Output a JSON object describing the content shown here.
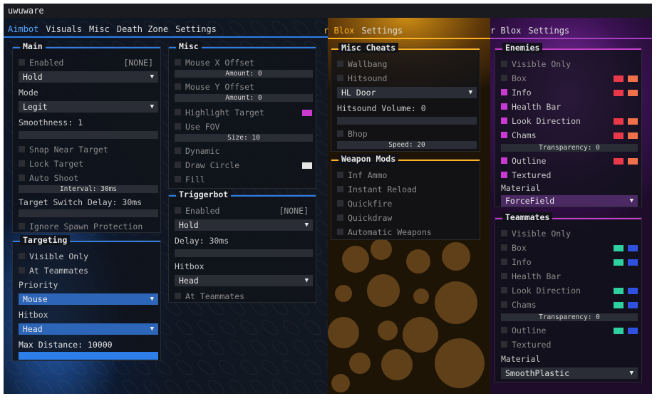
{
  "window": {
    "title": "uwuware"
  },
  "colors": {
    "blue": "#2d7ee8",
    "amber": "#ffb120",
    "purple": "#c93bd0"
  },
  "aimbot_window": {
    "tabs": [
      {
        "label": "Aimbot",
        "active": true
      },
      {
        "label": "Visuals",
        "active": false
      },
      {
        "label": "Misc",
        "active": false
      },
      {
        "label": "Death Zone",
        "active": false
      },
      {
        "label": "Settings",
        "active": false
      }
    ],
    "main": {
      "title": "Main",
      "enabled_label": "Enabled",
      "enabled_key": "[NONE]",
      "activation_value": "Hold",
      "mode_label": "Mode",
      "mode_value": "Legit",
      "smoothness_label": "Smoothness: 1",
      "snap_near_target": "Snap Near Target",
      "lock_target": "Lock Target",
      "auto_shoot": "Auto Shoot",
      "interval_label": "Interval: 30ms",
      "switch_delay_label": "Target Switch Delay: 30ms",
      "ignore_spawn": "Ignore Spawn Protection"
    },
    "targeting": {
      "title": "Targeting",
      "visible_only": "Visible Only",
      "at_teammates": "At Teammates",
      "priority_label": "Priority",
      "priority_value": "Mouse",
      "hitbox_label": "Hitbox",
      "hitbox_value": "Head",
      "max_distance_label": "Max Distance: 10000",
      "max_distance_fill": 1.0
    },
    "misc": {
      "title": "Misc",
      "mouse_x_offset": "Mouse X Offset",
      "amount_x": "Amount: 0",
      "mouse_y_offset": "Mouse Y Offset",
      "amount_y": "Amount: 0",
      "highlight_target": "Highlight Target",
      "use_fov": "Use FOV",
      "size_label": "Size: 10",
      "dynamic": "Dynamic",
      "draw_circle": "Draw Circle",
      "fill": "Fill"
    },
    "triggerbot": {
      "title": "Triggerbot",
      "enabled_label": "Enabled",
      "enabled_key": "[NONE]",
      "activation_value": "Hold",
      "delay_label": "Delay: 30ms",
      "hitbox_label": "Hitbox",
      "hitbox_value": "Head",
      "at_teammates": "At Teammates"
    }
  },
  "blox_window": {
    "tabs": [
      {
        "label": "r Blox",
        "active": true
      },
      {
        "label": "Settings",
        "active": false
      }
    ],
    "misc_cheats": {
      "title": "Misc Cheats",
      "wallbang": "Wallbang",
      "hitsound": "Hitsound",
      "hitsound_value": "HL Door",
      "hitsound_volume_label": "Hitsound Volume: 0",
      "bhop": "Bhop",
      "speed_label": "Speed: 20"
    },
    "weapon_mods": {
      "title": "Weapon Mods",
      "inf_ammo": "Inf Ammo",
      "instant_reload": "Instant Reload",
      "quickfire": "Quickfire",
      "quickdraw": "Quickdraw",
      "automatic_weapons": "Automatic Weapons"
    }
  },
  "visuals_window": {
    "tabs": [
      {
        "label": "r Blox",
        "active": false
      },
      {
        "label": "Settings",
        "active": false
      }
    ],
    "enemies": {
      "title": "Enemies",
      "visible_only": "Visible Only",
      "box": "Box",
      "info": "Info",
      "health_bar": "Health Bar",
      "look_direction": "Look Direction",
      "chams": "Chams",
      "transparency_label": "Transparency: 0",
      "outline": "Outline",
      "textured": "Textured",
      "material_label": "Material",
      "material_value": "ForceField"
    },
    "teammates": {
      "title": "Teammates",
      "visible_only": "Visible Only",
      "box": "Box",
      "info": "Info",
      "health_bar": "Health Bar",
      "look_direction": "Look Direction",
      "chams": "Chams",
      "transparency_label": "Transparency: 0",
      "outline": "Outline",
      "textured": "Textured",
      "material_label": "Material",
      "material_value": "SmoothPlastic"
    }
  }
}
